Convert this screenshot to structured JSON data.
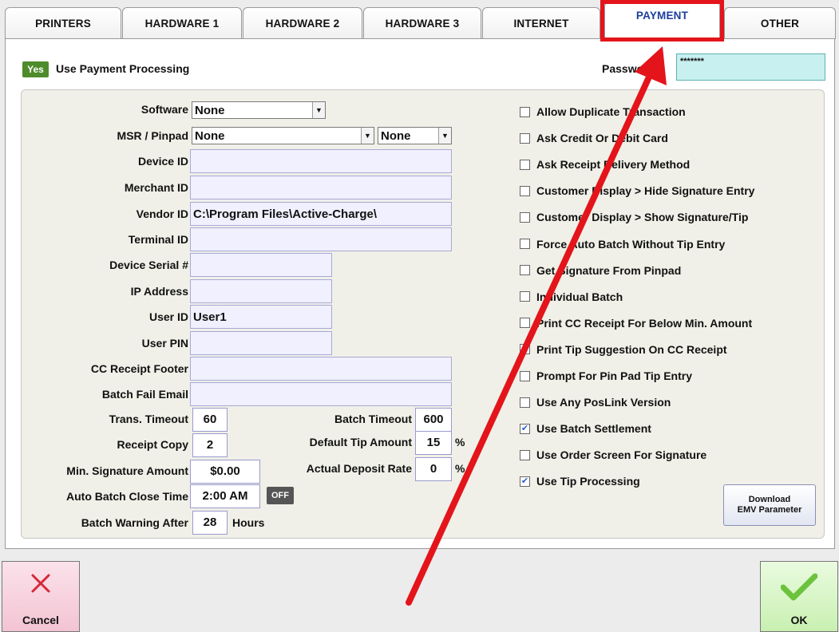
{
  "tabs": [
    {
      "label": "PRINTERS"
    },
    {
      "label": "HARDWARE 1"
    },
    {
      "label": "HARDWARE 2"
    },
    {
      "label": "HARDWARE 3"
    },
    {
      "label": "INTERNET"
    },
    {
      "label": "PAYMENT",
      "active": true
    },
    {
      "label": "OTHER"
    }
  ],
  "header": {
    "yes_badge": "Yes",
    "use_payment_label": "Use Payment Processing",
    "password_label": "Password",
    "password_value": "*******"
  },
  "form": {
    "software_label": "Software",
    "software_value": "None",
    "msr_label": "MSR / Pinpad",
    "msr_value": "None",
    "msr_value2": "None",
    "device_id_label": "Device ID",
    "device_id_value": "",
    "merchant_id_label": "Merchant ID",
    "merchant_id_value": "",
    "vendor_id_label": "Vendor ID",
    "vendor_id_value": "C:\\Program Files\\Active-Charge\\",
    "terminal_id_label": "Terminal ID",
    "terminal_id_value": "",
    "device_serial_label": "Device Serial #",
    "device_serial_value": "",
    "ip_address_label": "IP Address",
    "ip_address_value": "",
    "user_id_label": "User ID",
    "user_id_value": "User1",
    "user_pin_label": "User PIN",
    "user_pin_value": "",
    "cc_footer_label": "CC Receipt Footer",
    "cc_footer_value": "",
    "batch_fail_label": "Batch Fail Email",
    "batch_fail_value": "",
    "trans_timeout_label": "Trans. Timeout",
    "trans_timeout_value": "60",
    "batch_timeout_label": "Batch Timeout",
    "batch_timeout_value": "600",
    "receipt_copy_label": "Receipt Copy",
    "receipt_copy_value": "2",
    "default_tip_label": "Default Tip Amount",
    "default_tip_value": "15",
    "default_tip_unit": "%",
    "min_sig_label": "Min. Signature Amount",
    "min_sig_value": "$0.00",
    "deposit_rate_label": "Actual Deposit Rate",
    "deposit_rate_value": "0",
    "deposit_rate_unit": "%",
    "auto_batch_label": "Auto Batch Close Time",
    "auto_batch_value": "2:00 AM",
    "auto_batch_toggle": "OFF",
    "batch_warning_label": "Batch Warning After",
    "batch_warning_value": "28",
    "batch_warning_unit": "Hours"
  },
  "options": [
    {
      "label": "Allow Duplicate Transaction",
      "checked": false
    },
    {
      "label": "Ask Credit Or Debit Card",
      "checked": false
    },
    {
      "label": "Ask Receipt Delivery Method",
      "checked": false
    },
    {
      "label": "Customer Display > Hide Signature Entry",
      "checked": false
    },
    {
      "label": "Customer Display > Show Signature/Tip",
      "checked": false
    },
    {
      "label": "Force Auto Batch Without Tip Entry",
      "checked": false
    },
    {
      "label": "Get Signature From Pinpad",
      "checked": false
    },
    {
      "label": "Individual Batch",
      "checked": false
    },
    {
      "label": "Print CC Receipt For Below Min. Amount",
      "checked": false
    },
    {
      "label": "Print Tip Suggestion On CC Receipt",
      "checked": false
    },
    {
      "label": "Prompt For Pin Pad Tip Entry",
      "checked": false
    },
    {
      "label": "Use Any PosLink Version",
      "checked": false
    },
    {
      "label": "Use Batch Settlement",
      "checked": true
    },
    {
      "label": "Use Order Screen For Signature",
      "checked": false
    },
    {
      "label": "Use Tip Processing",
      "checked": true
    }
  ],
  "emv_button": {
    "line1": "Download",
    "line2": "EMV Parameter"
  },
  "bottom": {
    "cancel_label": "Cancel",
    "ok_label": "OK"
  },
  "colors": {
    "accent": "#1d3f9a",
    "highlight": "#e4141b",
    "yes_green": "#4e8b2b",
    "check_blue": "#2b5fc7"
  },
  "icons": {
    "cancel": "x-icon",
    "ok": "checkmark-icon",
    "annotation": "red-arrow-icon"
  }
}
